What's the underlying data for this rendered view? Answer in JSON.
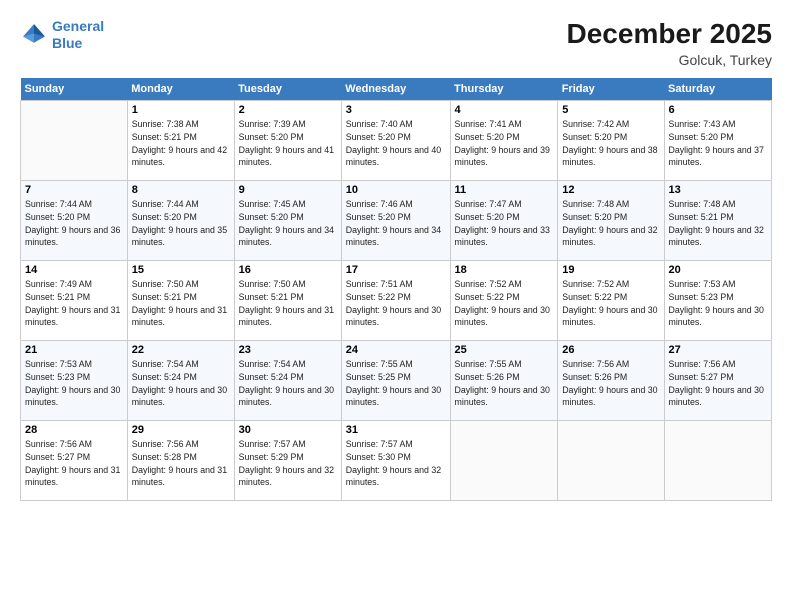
{
  "logo": {
    "line1": "General",
    "line2": "Blue"
  },
  "title": "December 2025",
  "subtitle": "Golcuk, Turkey",
  "header_days": [
    "Sunday",
    "Monday",
    "Tuesday",
    "Wednesday",
    "Thursday",
    "Friday",
    "Saturday"
  ],
  "weeks": [
    [
      {
        "day": "",
        "sunrise": "",
        "sunset": "",
        "daylight": ""
      },
      {
        "day": "1",
        "sunrise": "Sunrise: 7:38 AM",
        "sunset": "Sunset: 5:21 PM",
        "daylight": "Daylight: 9 hours and 42 minutes."
      },
      {
        "day": "2",
        "sunrise": "Sunrise: 7:39 AM",
        "sunset": "Sunset: 5:20 PM",
        "daylight": "Daylight: 9 hours and 41 minutes."
      },
      {
        "day": "3",
        "sunrise": "Sunrise: 7:40 AM",
        "sunset": "Sunset: 5:20 PM",
        "daylight": "Daylight: 9 hours and 40 minutes."
      },
      {
        "day": "4",
        "sunrise": "Sunrise: 7:41 AM",
        "sunset": "Sunset: 5:20 PM",
        "daylight": "Daylight: 9 hours and 39 minutes."
      },
      {
        "day": "5",
        "sunrise": "Sunrise: 7:42 AM",
        "sunset": "Sunset: 5:20 PM",
        "daylight": "Daylight: 9 hours and 38 minutes."
      },
      {
        "day": "6",
        "sunrise": "Sunrise: 7:43 AM",
        "sunset": "Sunset: 5:20 PM",
        "daylight": "Daylight: 9 hours and 37 minutes."
      }
    ],
    [
      {
        "day": "7",
        "sunrise": "Sunrise: 7:44 AM",
        "sunset": "Sunset: 5:20 PM",
        "daylight": "Daylight: 9 hours and 36 minutes."
      },
      {
        "day": "8",
        "sunrise": "Sunrise: 7:44 AM",
        "sunset": "Sunset: 5:20 PM",
        "daylight": "Daylight: 9 hours and 35 minutes."
      },
      {
        "day": "9",
        "sunrise": "Sunrise: 7:45 AM",
        "sunset": "Sunset: 5:20 PM",
        "daylight": "Daylight: 9 hours and 34 minutes."
      },
      {
        "day": "10",
        "sunrise": "Sunrise: 7:46 AM",
        "sunset": "Sunset: 5:20 PM",
        "daylight": "Daylight: 9 hours and 34 minutes."
      },
      {
        "day": "11",
        "sunrise": "Sunrise: 7:47 AM",
        "sunset": "Sunset: 5:20 PM",
        "daylight": "Daylight: 9 hours and 33 minutes."
      },
      {
        "day": "12",
        "sunrise": "Sunrise: 7:48 AM",
        "sunset": "Sunset: 5:20 PM",
        "daylight": "Daylight: 9 hours and 32 minutes."
      },
      {
        "day": "13",
        "sunrise": "Sunrise: 7:48 AM",
        "sunset": "Sunset: 5:21 PM",
        "daylight": "Daylight: 9 hours and 32 minutes."
      }
    ],
    [
      {
        "day": "14",
        "sunrise": "Sunrise: 7:49 AM",
        "sunset": "Sunset: 5:21 PM",
        "daylight": "Daylight: 9 hours and 31 minutes."
      },
      {
        "day": "15",
        "sunrise": "Sunrise: 7:50 AM",
        "sunset": "Sunset: 5:21 PM",
        "daylight": "Daylight: 9 hours and 31 minutes."
      },
      {
        "day": "16",
        "sunrise": "Sunrise: 7:50 AM",
        "sunset": "Sunset: 5:21 PM",
        "daylight": "Daylight: 9 hours and 31 minutes."
      },
      {
        "day": "17",
        "sunrise": "Sunrise: 7:51 AM",
        "sunset": "Sunset: 5:22 PM",
        "daylight": "Daylight: 9 hours and 30 minutes."
      },
      {
        "day": "18",
        "sunrise": "Sunrise: 7:52 AM",
        "sunset": "Sunset: 5:22 PM",
        "daylight": "Daylight: 9 hours and 30 minutes."
      },
      {
        "day": "19",
        "sunrise": "Sunrise: 7:52 AM",
        "sunset": "Sunset: 5:22 PM",
        "daylight": "Daylight: 9 hours and 30 minutes."
      },
      {
        "day": "20",
        "sunrise": "Sunrise: 7:53 AM",
        "sunset": "Sunset: 5:23 PM",
        "daylight": "Daylight: 9 hours and 30 minutes."
      }
    ],
    [
      {
        "day": "21",
        "sunrise": "Sunrise: 7:53 AM",
        "sunset": "Sunset: 5:23 PM",
        "daylight": "Daylight: 9 hours and 30 minutes."
      },
      {
        "day": "22",
        "sunrise": "Sunrise: 7:54 AM",
        "sunset": "Sunset: 5:24 PM",
        "daylight": "Daylight: 9 hours and 30 minutes."
      },
      {
        "day": "23",
        "sunrise": "Sunrise: 7:54 AM",
        "sunset": "Sunset: 5:24 PM",
        "daylight": "Daylight: 9 hours and 30 minutes."
      },
      {
        "day": "24",
        "sunrise": "Sunrise: 7:55 AM",
        "sunset": "Sunset: 5:25 PM",
        "daylight": "Daylight: 9 hours and 30 minutes."
      },
      {
        "day": "25",
        "sunrise": "Sunrise: 7:55 AM",
        "sunset": "Sunset: 5:26 PM",
        "daylight": "Daylight: 9 hours and 30 minutes."
      },
      {
        "day": "26",
        "sunrise": "Sunrise: 7:56 AM",
        "sunset": "Sunset: 5:26 PM",
        "daylight": "Daylight: 9 hours and 30 minutes."
      },
      {
        "day": "27",
        "sunrise": "Sunrise: 7:56 AM",
        "sunset": "Sunset: 5:27 PM",
        "daylight": "Daylight: 9 hours and 30 minutes."
      }
    ],
    [
      {
        "day": "28",
        "sunrise": "Sunrise: 7:56 AM",
        "sunset": "Sunset: 5:27 PM",
        "daylight": "Daylight: 9 hours and 31 minutes."
      },
      {
        "day": "29",
        "sunrise": "Sunrise: 7:56 AM",
        "sunset": "Sunset: 5:28 PM",
        "daylight": "Daylight: 9 hours and 31 minutes."
      },
      {
        "day": "30",
        "sunrise": "Sunrise: 7:57 AM",
        "sunset": "Sunset: 5:29 PM",
        "daylight": "Daylight: 9 hours and 32 minutes."
      },
      {
        "day": "31",
        "sunrise": "Sunrise: 7:57 AM",
        "sunset": "Sunset: 5:30 PM",
        "daylight": "Daylight: 9 hours and 32 minutes."
      },
      {
        "day": "",
        "sunrise": "",
        "sunset": "",
        "daylight": ""
      },
      {
        "day": "",
        "sunrise": "",
        "sunset": "",
        "daylight": ""
      },
      {
        "day": "",
        "sunrise": "",
        "sunset": "",
        "daylight": ""
      }
    ]
  ]
}
